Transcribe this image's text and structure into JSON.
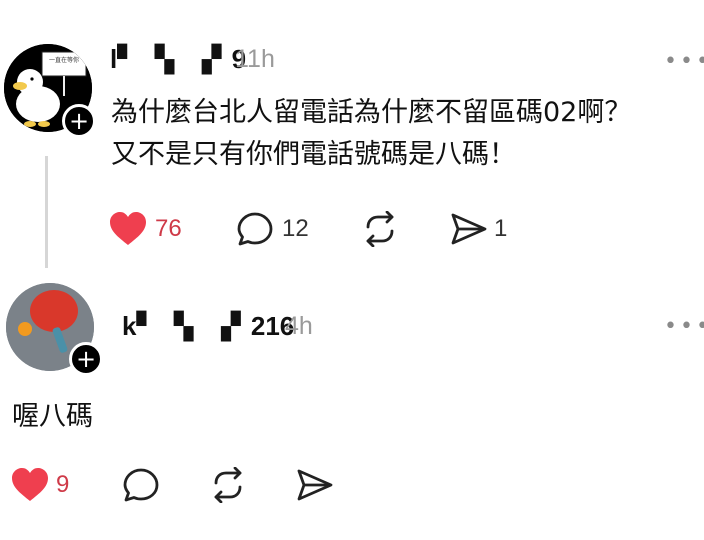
{
  "posts": [
    {
      "username": "l▘ ▝▖ ▗▘9",
      "time": "11h",
      "content_lines": [
        "為什麼台北人留電話為什麼不留區碼02啊？",
        "又不是只有你們電話號碼是八碼！"
      ],
      "avatar_sign_text": "一直在等你",
      "likes": "76",
      "comments": "12",
      "reposts": "",
      "shares": "1"
    },
    {
      "username": "k▘ ▝▖ ▗▘216",
      "time": "4h",
      "content": "喔八碼",
      "likes": "9",
      "comments": "",
      "reposts": "",
      "shares": ""
    }
  ],
  "follow_symbol": "+",
  "more_symbol": "•••",
  "colors": {
    "like_red": "#ef3f4f",
    "muted": "#9a9a9a",
    "line": "#d6d6d6"
  },
  "icons": [
    "heart-icon",
    "comment-icon",
    "repost-icon",
    "share-icon",
    "more-icon",
    "plus-icon"
  ]
}
